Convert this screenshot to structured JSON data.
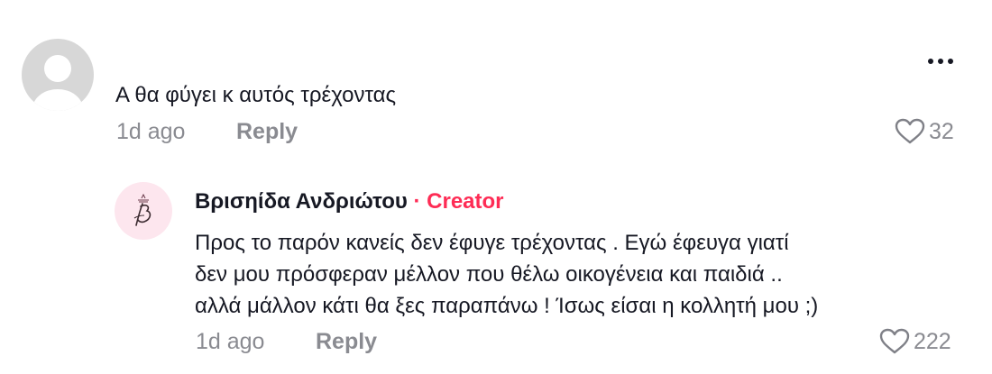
{
  "comment": {
    "text": "Α θα φύγει κ αυτός τρέχοντας",
    "time": "1d ago",
    "reply_label": "Reply",
    "likes": "32"
  },
  "reply": {
    "author": "Βρισηίδα Ανδριώτου",
    "badge": "· Creator",
    "text_lines": [
      "Προς το παρόν κανείς δεν έφυγε τρέχοντας . Εγώ έφευγα γιατί",
      "δεν μου πρόσφεραν μέλλον που θέλω οικογένεια και παιδιά ..",
      "αλλά μάλλον κάτι θα ξες παραπάνω ! Ίσως είσαι η κολλητή μου ;)"
    ],
    "time": "1d ago",
    "reply_label": "Reply",
    "likes": "222"
  },
  "icons": {
    "avatar": "default-avatar-icon",
    "more": "more-options-icon",
    "like": "heart-outline-icon"
  },
  "colors": {
    "text": "#161823",
    "muted": "#8a8b91",
    "creator": "#fe2c55",
    "avatar_bg": "#d7d7d7",
    "reply_avatar_bg": "#fde6ee"
  }
}
